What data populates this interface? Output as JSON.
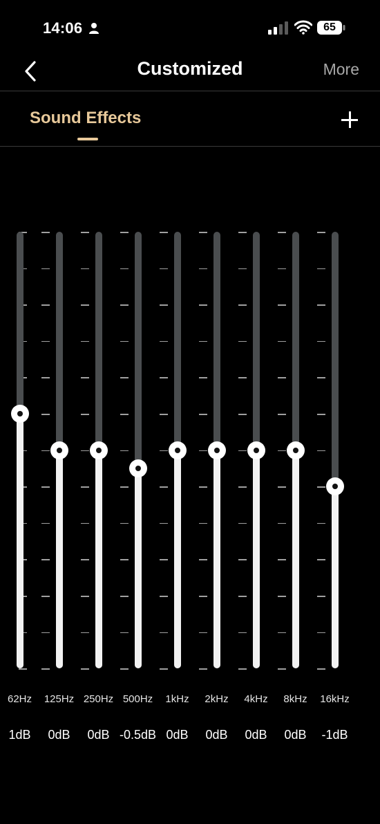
{
  "status_bar": {
    "time": "14:06",
    "battery": "65"
  },
  "header": {
    "title": "Customized",
    "more_label": "More"
  },
  "tabs": {
    "active_label": "Sound Effects",
    "accent_color": "#e8c99a"
  },
  "equalizer": {
    "range_db": [
      -6,
      6
    ],
    "bands": [
      {
        "freq": "62Hz",
        "gain_label": "1dB",
        "gain": 1
      },
      {
        "freq": "125Hz",
        "gain_label": "0dB",
        "gain": 0
      },
      {
        "freq": "250Hz",
        "gain_label": "0dB",
        "gain": 0
      },
      {
        "freq": "500Hz",
        "gain_label": "-0.5dB",
        "gain": -0.5
      },
      {
        "freq": "1kHz",
        "gain_label": "0dB",
        "gain": 0
      },
      {
        "freq": "2kHz",
        "gain_label": "0dB",
        "gain": 0
      },
      {
        "freq": "4kHz",
        "gain_label": "0dB",
        "gain": 0
      },
      {
        "freq": "8kHz",
        "gain_label": "0dB",
        "gain": 0
      },
      {
        "freq": "16kHz",
        "gain_label": "-1dB",
        "gain": -1
      }
    ]
  }
}
